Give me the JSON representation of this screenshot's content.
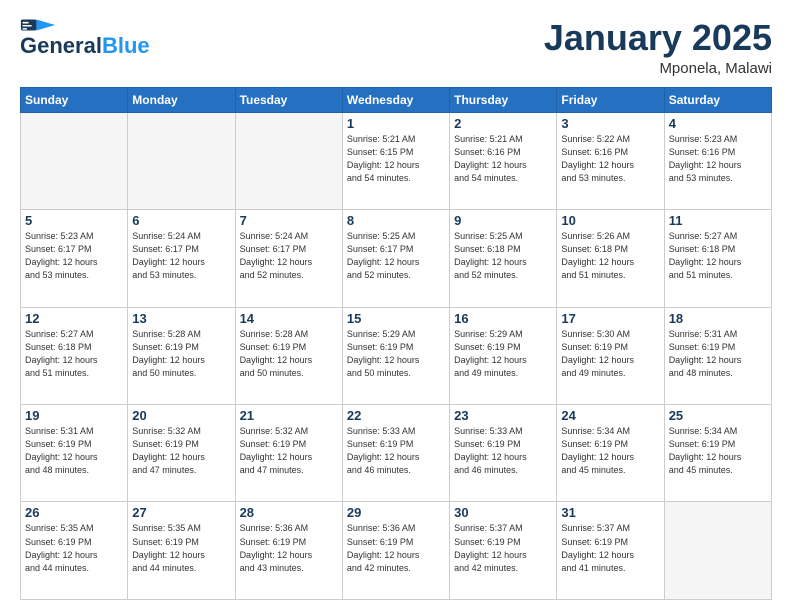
{
  "header": {
    "logo_line1": "General",
    "logo_line2": "Blue",
    "title": "January 2025",
    "subtitle": "Mponela, Malawi"
  },
  "days_of_week": [
    "Sunday",
    "Monday",
    "Tuesday",
    "Wednesday",
    "Thursday",
    "Friday",
    "Saturday"
  ],
  "weeks": [
    [
      {
        "day": "",
        "info": "",
        "empty": true
      },
      {
        "day": "",
        "info": "",
        "empty": true
      },
      {
        "day": "",
        "info": "",
        "empty": true
      },
      {
        "day": "1",
        "info": "Sunrise: 5:21 AM\nSunset: 6:15 PM\nDaylight: 12 hours\nand 54 minutes.",
        "empty": false
      },
      {
        "day": "2",
        "info": "Sunrise: 5:21 AM\nSunset: 6:16 PM\nDaylight: 12 hours\nand 54 minutes.",
        "empty": false
      },
      {
        "day": "3",
        "info": "Sunrise: 5:22 AM\nSunset: 6:16 PM\nDaylight: 12 hours\nand 53 minutes.",
        "empty": false
      },
      {
        "day": "4",
        "info": "Sunrise: 5:23 AM\nSunset: 6:16 PM\nDaylight: 12 hours\nand 53 minutes.",
        "empty": false
      }
    ],
    [
      {
        "day": "5",
        "info": "Sunrise: 5:23 AM\nSunset: 6:17 PM\nDaylight: 12 hours\nand 53 minutes.",
        "empty": false
      },
      {
        "day": "6",
        "info": "Sunrise: 5:24 AM\nSunset: 6:17 PM\nDaylight: 12 hours\nand 53 minutes.",
        "empty": false
      },
      {
        "day": "7",
        "info": "Sunrise: 5:24 AM\nSunset: 6:17 PM\nDaylight: 12 hours\nand 52 minutes.",
        "empty": false
      },
      {
        "day": "8",
        "info": "Sunrise: 5:25 AM\nSunset: 6:17 PM\nDaylight: 12 hours\nand 52 minutes.",
        "empty": false
      },
      {
        "day": "9",
        "info": "Sunrise: 5:25 AM\nSunset: 6:18 PM\nDaylight: 12 hours\nand 52 minutes.",
        "empty": false
      },
      {
        "day": "10",
        "info": "Sunrise: 5:26 AM\nSunset: 6:18 PM\nDaylight: 12 hours\nand 51 minutes.",
        "empty": false
      },
      {
        "day": "11",
        "info": "Sunrise: 5:27 AM\nSunset: 6:18 PM\nDaylight: 12 hours\nand 51 minutes.",
        "empty": false
      }
    ],
    [
      {
        "day": "12",
        "info": "Sunrise: 5:27 AM\nSunset: 6:18 PM\nDaylight: 12 hours\nand 51 minutes.",
        "empty": false
      },
      {
        "day": "13",
        "info": "Sunrise: 5:28 AM\nSunset: 6:19 PM\nDaylight: 12 hours\nand 50 minutes.",
        "empty": false
      },
      {
        "day": "14",
        "info": "Sunrise: 5:28 AM\nSunset: 6:19 PM\nDaylight: 12 hours\nand 50 minutes.",
        "empty": false
      },
      {
        "day": "15",
        "info": "Sunrise: 5:29 AM\nSunset: 6:19 PM\nDaylight: 12 hours\nand 50 minutes.",
        "empty": false
      },
      {
        "day": "16",
        "info": "Sunrise: 5:29 AM\nSunset: 6:19 PM\nDaylight: 12 hours\nand 49 minutes.",
        "empty": false
      },
      {
        "day": "17",
        "info": "Sunrise: 5:30 AM\nSunset: 6:19 PM\nDaylight: 12 hours\nand 49 minutes.",
        "empty": false
      },
      {
        "day": "18",
        "info": "Sunrise: 5:31 AM\nSunset: 6:19 PM\nDaylight: 12 hours\nand 48 minutes.",
        "empty": false
      }
    ],
    [
      {
        "day": "19",
        "info": "Sunrise: 5:31 AM\nSunset: 6:19 PM\nDaylight: 12 hours\nand 48 minutes.",
        "empty": false
      },
      {
        "day": "20",
        "info": "Sunrise: 5:32 AM\nSunset: 6:19 PM\nDaylight: 12 hours\nand 47 minutes.",
        "empty": false
      },
      {
        "day": "21",
        "info": "Sunrise: 5:32 AM\nSunset: 6:19 PM\nDaylight: 12 hours\nand 47 minutes.",
        "empty": false
      },
      {
        "day": "22",
        "info": "Sunrise: 5:33 AM\nSunset: 6:19 PM\nDaylight: 12 hours\nand 46 minutes.",
        "empty": false
      },
      {
        "day": "23",
        "info": "Sunrise: 5:33 AM\nSunset: 6:19 PM\nDaylight: 12 hours\nand 46 minutes.",
        "empty": false
      },
      {
        "day": "24",
        "info": "Sunrise: 5:34 AM\nSunset: 6:19 PM\nDaylight: 12 hours\nand 45 minutes.",
        "empty": false
      },
      {
        "day": "25",
        "info": "Sunrise: 5:34 AM\nSunset: 6:19 PM\nDaylight: 12 hours\nand 45 minutes.",
        "empty": false
      }
    ],
    [
      {
        "day": "26",
        "info": "Sunrise: 5:35 AM\nSunset: 6:19 PM\nDaylight: 12 hours\nand 44 minutes.",
        "empty": false
      },
      {
        "day": "27",
        "info": "Sunrise: 5:35 AM\nSunset: 6:19 PM\nDaylight: 12 hours\nand 44 minutes.",
        "empty": false
      },
      {
        "day": "28",
        "info": "Sunrise: 5:36 AM\nSunset: 6:19 PM\nDaylight: 12 hours\nand 43 minutes.",
        "empty": false
      },
      {
        "day": "29",
        "info": "Sunrise: 5:36 AM\nSunset: 6:19 PM\nDaylight: 12 hours\nand 42 minutes.",
        "empty": false
      },
      {
        "day": "30",
        "info": "Sunrise: 5:37 AM\nSunset: 6:19 PM\nDaylight: 12 hours\nand 42 minutes.",
        "empty": false
      },
      {
        "day": "31",
        "info": "Sunrise: 5:37 AM\nSunset: 6:19 PM\nDaylight: 12 hours\nand 41 minutes.",
        "empty": false
      },
      {
        "day": "",
        "info": "",
        "empty": true
      }
    ]
  ]
}
